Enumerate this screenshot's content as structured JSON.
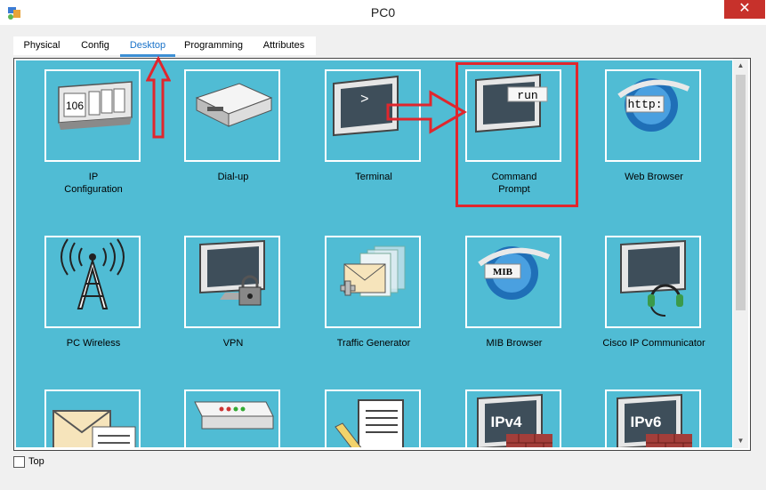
{
  "window": {
    "title": "PC0",
    "close_glyph": "✕"
  },
  "tabs": [
    {
      "label": "Physical",
      "active": false
    },
    {
      "label": "Config",
      "active": false
    },
    {
      "label": "Desktop",
      "active": true
    },
    {
      "label": "Programming",
      "active": false
    },
    {
      "label": "Attributes",
      "active": false
    }
  ],
  "desktop": {
    "apps": [
      {
        "label": "IP\nConfiguration",
        "icon": "ip-config-icon",
        "icon_text": "106"
      },
      {
        "label": "Dial-up",
        "icon": "modem-icon"
      },
      {
        "label": "Terminal",
        "icon": "terminal-icon",
        "icon_text": ">"
      },
      {
        "label": "Command\nPrompt",
        "icon": "command-prompt-icon",
        "icon_text": "run"
      },
      {
        "label": "Web Browser",
        "icon": "web-browser-icon",
        "icon_text": "http:"
      },
      {
        "label": "PC Wireless",
        "icon": "wireless-icon"
      },
      {
        "label": "VPN",
        "icon": "vpn-icon"
      },
      {
        "label": "Traffic Generator",
        "icon": "traffic-generator-icon"
      },
      {
        "label": "MIB Browser",
        "icon": "mib-browser-icon",
        "icon_text": "MIB"
      },
      {
        "label": "Cisco IP Communicator",
        "icon": "ip-communicator-icon"
      },
      {
        "label": "",
        "icon": "email-icon"
      },
      {
        "label": "",
        "icon": "pppoe-dialer-icon"
      },
      {
        "label": "",
        "icon": "text-editor-icon"
      },
      {
        "label": "",
        "icon": "firewall-ipv4-icon",
        "icon_text": "IPv4"
      },
      {
        "label": "",
        "icon": "firewall-ipv6-icon",
        "icon_text": "IPv6"
      }
    ]
  },
  "footer": {
    "top_label": "Top",
    "top_checked": false
  },
  "colors": {
    "desktop_bg": "#50bcd4",
    "annotation": "#e0262d",
    "active_tab": "#1a73c9"
  }
}
